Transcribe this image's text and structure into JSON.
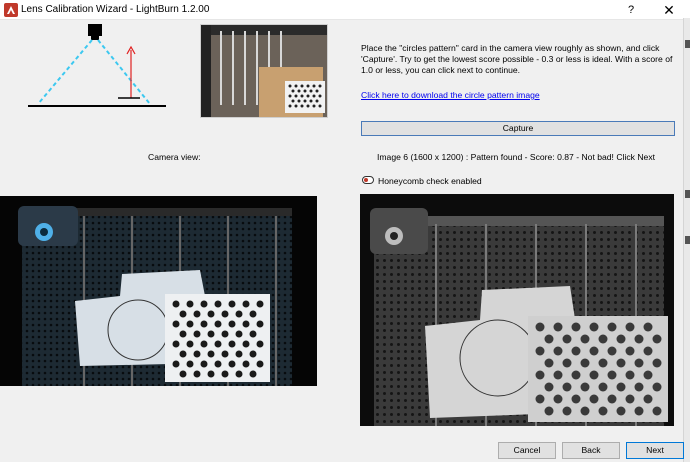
{
  "window": {
    "title": "Lens Calibration Wizard - LightBurn 1.2.00",
    "help_label": "?",
    "close_label": "✕",
    "icon": "lightburn-logo-icon"
  },
  "instructions": {
    "text": "Place the \"circles pattern\" card in the camera view roughly as shown, and click 'Capture'.  Try to get the lowest score possible - 0.3 or less is ideal.  With a score of 1.0 or less, you can click next to continue.",
    "download_link": "Click here to download the circle pattern image"
  },
  "capture_button": "Capture",
  "status": "Image 6 (1600 x 1200) : Pattern found - Score: 0.87 - Not bad! Click Next",
  "camera_label": "Camera view:",
  "honeycomb": {
    "label": "Honeycomb check enabled",
    "enabled": true
  },
  "footer": {
    "cancel": "Cancel",
    "back": "Back",
    "next": "Next"
  },
  "colors": {
    "accent": "#0078d7",
    "link": "#0000ee",
    "diagram_beam": "#3cc8f0",
    "diagram_arrow": "#e02020",
    "toggle_on": "#c0392b"
  }
}
